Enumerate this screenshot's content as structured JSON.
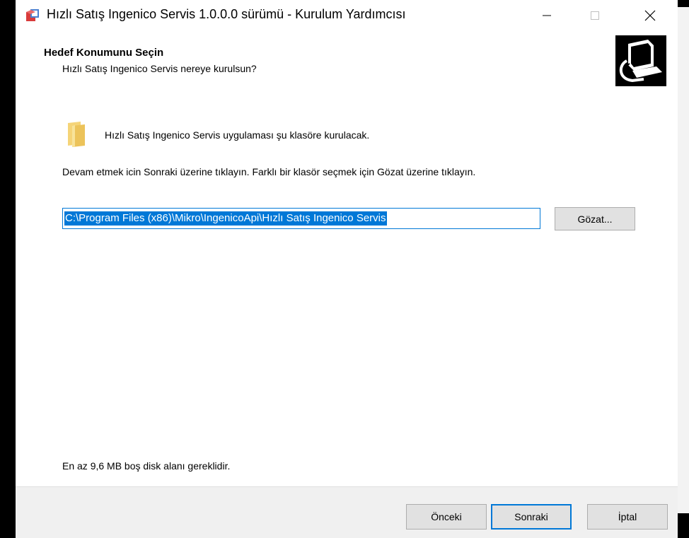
{
  "window": {
    "title": "Hızlı Satış Ingenico Servis 1.0.0.0 sürümü - Kurulum Yardımcısı"
  },
  "header": {
    "title": "Hedef Konumunu Seçin",
    "subtitle": "Hızlı Satış Ingenico Servis nereye kurulsun?"
  },
  "content": {
    "intro": "Hızlı Satış Ingenico Servis uygulaması şu klasöre kurulacak.",
    "instruction": "Devam etmek icin Sonraki üzerine tıklayın. Farklı bir klasör seçmek için Gözat üzerine tıklayın.",
    "path_value": "C:\\Program Files (x86)\\Mikro\\IngenicoApi\\Hızlı Satış Ingenico Servis",
    "browse_label": "Gözat...",
    "disk_space": "En az 9,6 MB boş disk alanı gereklidir."
  },
  "footer": {
    "back_label": "Önceki",
    "next_label": "Sonraki",
    "cancel_label": "İptal"
  },
  "icons": {
    "app": "installer-app-icon",
    "wizard": "computer-install-icon",
    "folder": "folder-icon",
    "minimize": "minimize-icon",
    "maximize": "maximize-icon",
    "close": "close-icon"
  },
  "colors": {
    "accent": "#0078d7",
    "button_bg": "#e1e1e1",
    "footer_bg": "#f0f0f0",
    "folder": "#f5d478"
  }
}
